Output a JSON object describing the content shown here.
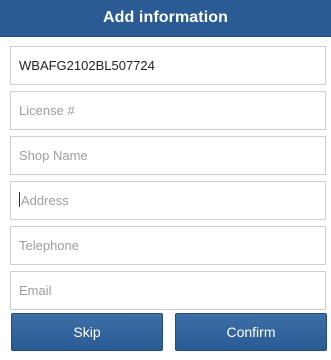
{
  "dialog": {
    "title": "Add information"
  },
  "fields": {
    "vin": {
      "value": "WBAFG2102BL507724",
      "placeholder": ""
    },
    "license": {
      "value": "",
      "placeholder": "License #"
    },
    "shop_name": {
      "value": "",
      "placeholder": "Shop Name"
    },
    "address": {
      "value": "",
      "placeholder": "Address"
    },
    "telephone": {
      "value": "",
      "placeholder": "Telephone"
    },
    "email": {
      "value": "",
      "placeholder": "Email"
    }
  },
  "buttons": {
    "skip_label": "Skip",
    "confirm_label": "Confirm"
  },
  "colors": {
    "header_background": "#2a5b95",
    "button_background": "#2a5b95",
    "field_border": "#cfcfcf",
    "placeholder_text": "#9e9e9e"
  }
}
